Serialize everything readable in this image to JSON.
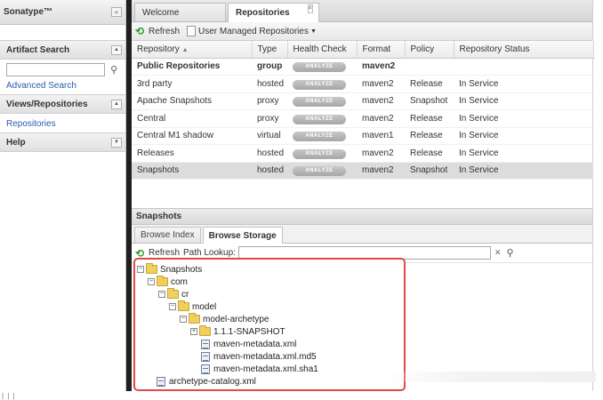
{
  "brand": "Sonatype™",
  "left": {
    "artifact_search": {
      "title": "Artifact Search",
      "link": "Advanced Search"
    },
    "views": {
      "title": "Views/Repositories",
      "link": "Repositories"
    },
    "help": {
      "title": "Help"
    }
  },
  "tabs": [
    {
      "label": "Welcome"
    },
    {
      "label": "Repositories"
    }
  ],
  "toolbar": {
    "refresh": "Refresh",
    "user_managed": "User Managed Repositories"
  },
  "columns": [
    "Repository",
    "Type",
    "Health Check",
    "Format",
    "Policy",
    "Repository Status"
  ],
  "analyze_label": "ANALYZE",
  "rows": [
    {
      "name": "Public Repositories",
      "type": "group",
      "health": "ANALYZE",
      "format": "maven2",
      "policy": "",
      "status": ""
    },
    {
      "name": "3rd party",
      "type": "hosted",
      "health": "ANALYZE",
      "format": "maven2",
      "policy": "Release",
      "status": "In Service"
    },
    {
      "name": "Apache Snapshots",
      "type": "proxy",
      "health": "ANALYZE",
      "format": "maven2",
      "policy": "Snapshot",
      "status": "In Service"
    },
    {
      "name": "Central",
      "type": "proxy",
      "health": "ANALYZE",
      "format": "maven2",
      "policy": "Release",
      "status": "In Service"
    },
    {
      "name": "Central M1 shadow",
      "type": "virtual",
      "health": "ANALYZE",
      "format": "maven1",
      "policy": "Release",
      "status": "In Service"
    },
    {
      "name": "Releases",
      "type": "hosted",
      "health": "ANALYZE",
      "format": "maven2",
      "policy": "Release",
      "status": "In Service"
    },
    {
      "name": "Snapshots",
      "type": "hosted",
      "health": "ANALYZE",
      "format": "maven2",
      "policy": "Snapshot",
      "status": "In Service"
    }
  ],
  "bottom": {
    "title": "Snapshots",
    "subtabs": [
      "Browse Index",
      "Browse Storage"
    ],
    "refresh": "Refresh",
    "path_lookup": "Path Lookup:"
  },
  "tree": {
    "root": "Snapshots",
    "com": "com",
    "cr": "cr",
    "model": "model",
    "archetype": "model-archetype",
    "snapshot": "1.1.1-SNAPSHOT",
    "file1": "maven-metadata.xml",
    "file2": "maven-metadata.xml.md5",
    "file3": "maven-metadata.xml.sha1",
    "catalog": "archetype-catalog.xml"
  }
}
